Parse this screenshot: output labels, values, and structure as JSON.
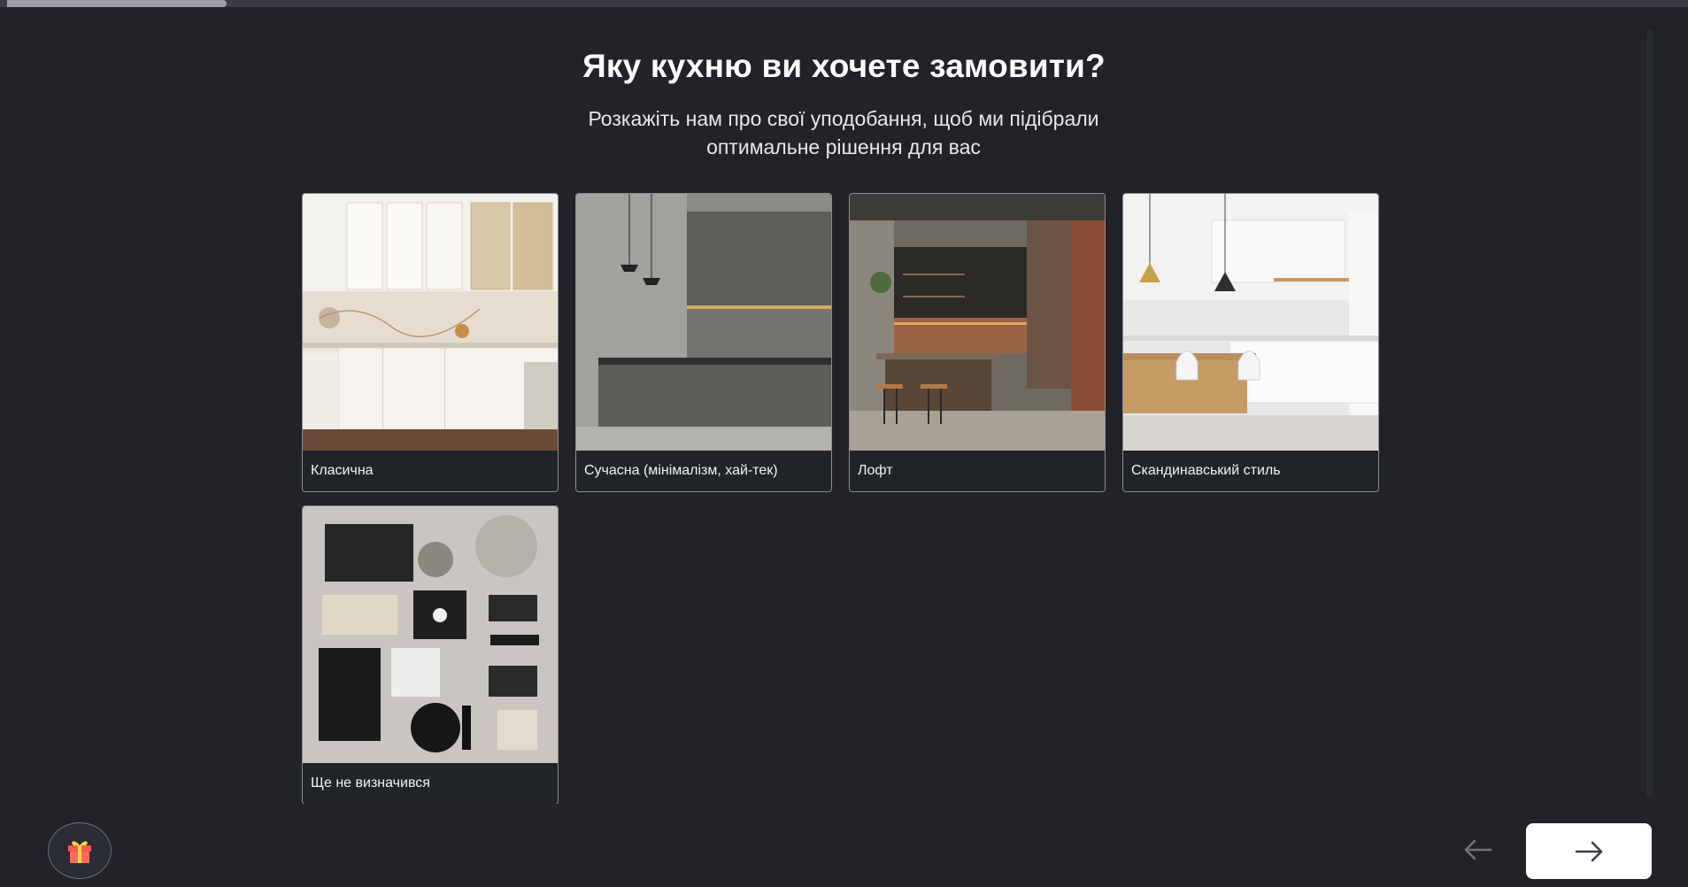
{
  "progress": {
    "fraction": 0.13
  },
  "header": {
    "title": "Яку кухню ви хочете замовити?",
    "subtitle_line1": "Розкажіть нам про свої уподобання, щоб ми підібрали",
    "subtitle_line2": "оптимальне рішення для вас"
  },
  "options": [
    {
      "label": "Класична",
      "image": "classic-kitchen-photo"
    },
    {
      "label": "Сучасна (мінімалізм, хай-тек)",
      "image": "modern-kitchen-photo"
    },
    {
      "label": "Лофт",
      "image": "loft-kitchen-photo"
    },
    {
      "label": "Скандинавський стиль",
      "image": "scandinavian-kitchen-photo"
    },
    {
      "label": "Ще не визначився",
      "image": "material-samples-photo"
    }
  ],
  "footer": {
    "gift_icon": "gift-icon",
    "back_icon": "arrow-left-icon",
    "next_icon": "arrow-right-icon"
  },
  "colors": {
    "background": "#212328",
    "text": "#ffffff",
    "card_border": "#8a8f96",
    "next_button": "#ffffff"
  }
}
